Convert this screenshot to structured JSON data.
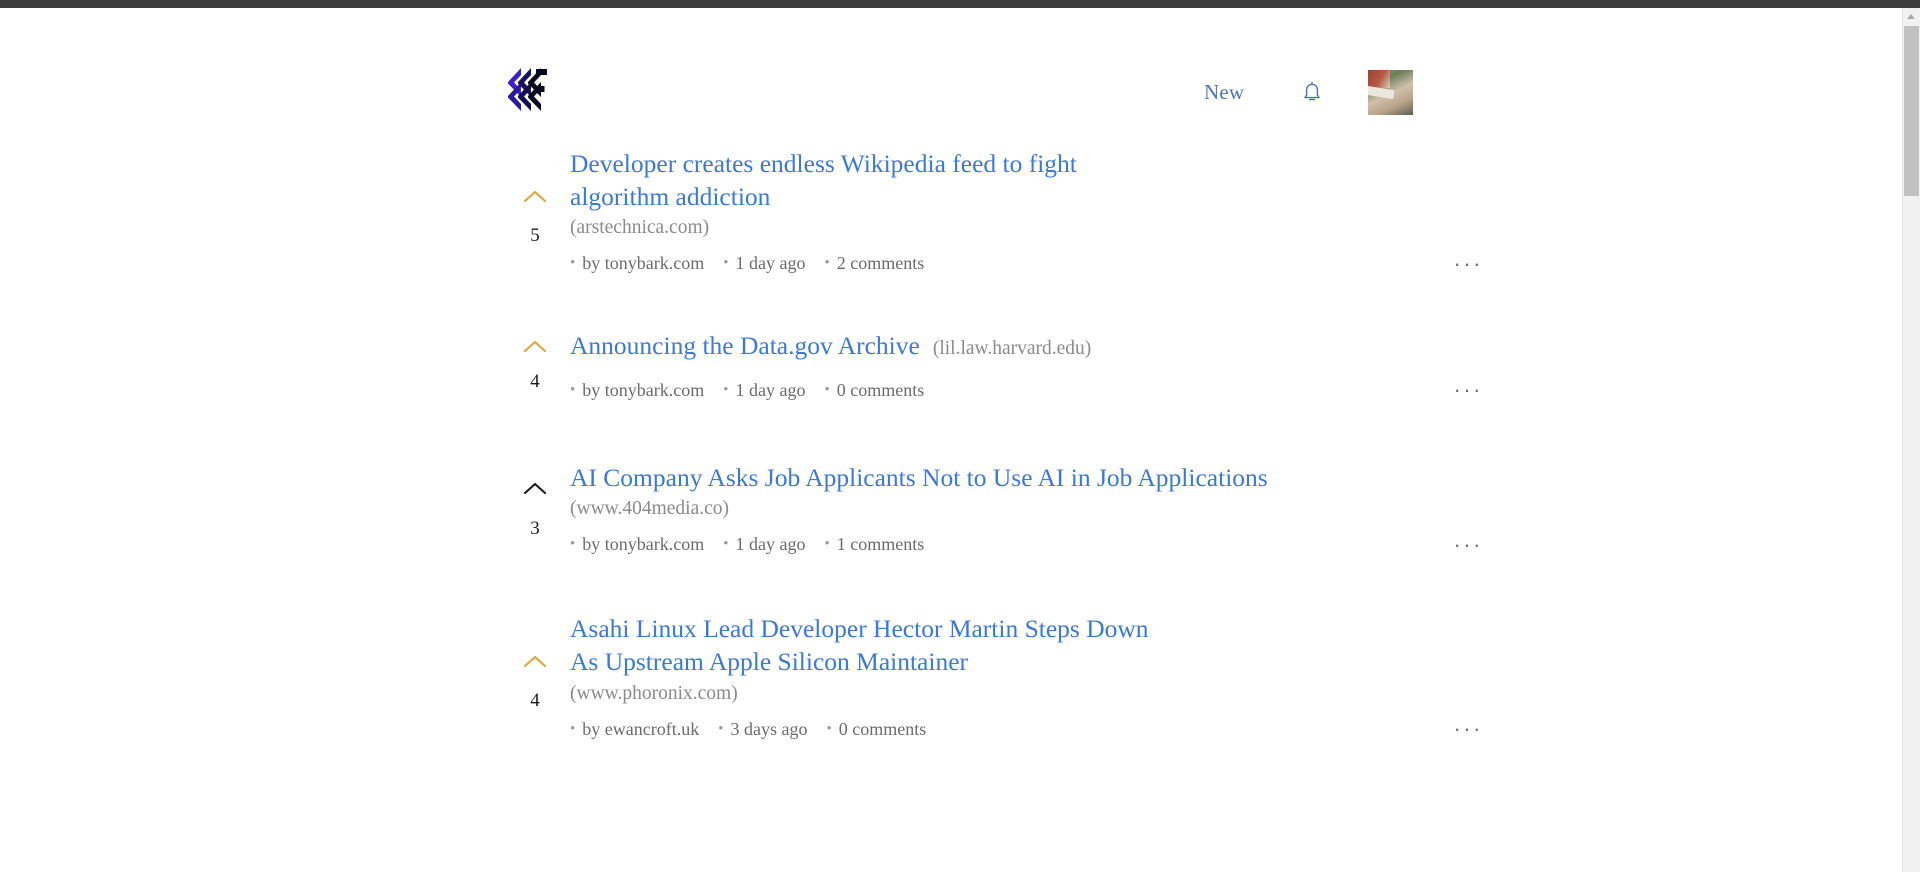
{
  "browser": {
    "scrollbar": {
      "present": true,
      "thumb_top_ratio": 0.02,
      "thumb_height_ratio": 0.2
    }
  },
  "header": {
    "logo_name": "flux-chevron-logo",
    "logo_colors": {
      "left_chevron": "#3b1fd0",
      "right_chevron": "#0a0a1e"
    },
    "nav": {
      "new_label": "New",
      "bell_icon": "bell-icon",
      "avatar_alt": "user avatar"
    }
  },
  "accent": {
    "link_blue": "#3b78d8",
    "nav_blue": "#4a72c4",
    "upvoted_amber": "#e2a33c",
    "unvoted_dark": "#1a1a1a",
    "muted_gray": "#8a8a8a"
  },
  "feed": {
    "posts": [
      {
        "title": "Developer creates endless Wikipedia feed to fight algorithm addiction",
        "domain": "(arstechnica.com)",
        "domain_position": "block",
        "score": "5",
        "voted": true,
        "by_label": "by tonybark.com",
        "age": "1 day ago",
        "comments": "2 comments",
        "more_label": "···"
      },
      {
        "title": "Announcing the Data.gov Archive",
        "domain": "(lil.law.harvard.edu)",
        "domain_position": "inline",
        "score": "4",
        "voted": true,
        "by_label": "by tonybark.com",
        "age": "1 day ago",
        "comments": "0 comments",
        "more_label": "···"
      },
      {
        "title": "AI Company Asks Job Applicants Not to Use AI in Job Applications",
        "domain": "(www.404media.co)",
        "domain_position": "block",
        "score": "3",
        "voted": false,
        "by_label": "by tonybark.com",
        "age": "1 day ago",
        "comments": "1 comments",
        "more_label": "···"
      },
      {
        "title": "Asahi Linux Lead Developer Hector Martin Steps Down As Upstream Apple Silicon Maintainer",
        "domain": "(www.phoronix.com)",
        "domain_position": "block",
        "score": "4",
        "voted": true,
        "by_label": "by ewancroft.uk",
        "age": "3 days ago",
        "comments": "0 comments",
        "more_label": "···"
      }
    ],
    "bullet": "•"
  }
}
